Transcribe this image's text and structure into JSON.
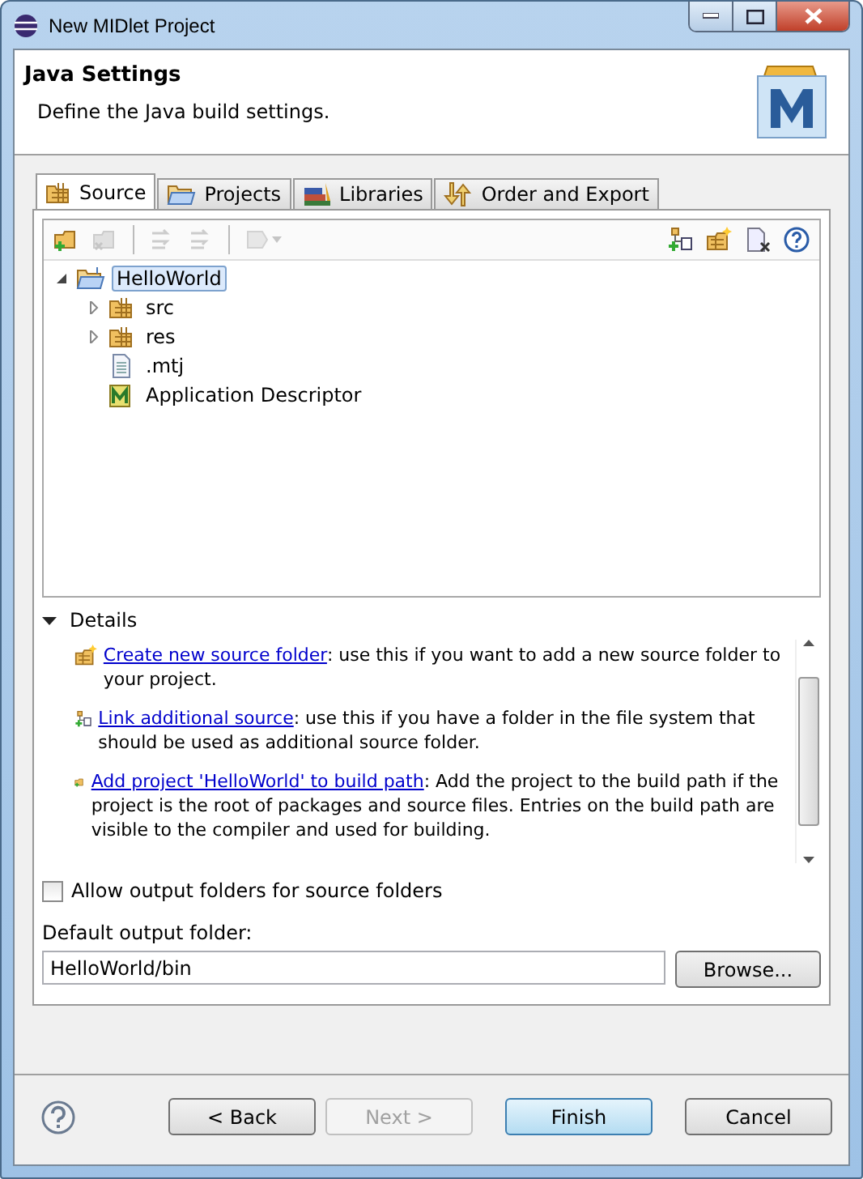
{
  "window": {
    "title": "New MIDlet Project"
  },
  "header": {
    "title": "Java Settings",
    "description": "Define the Java build settings."
  },
  "tabs": [
    {
      "label": "Source",
      "kind": "source",
      "selected": true
    },
    {
      "label": "Projects",
      "kind": "projects",
      "selected": false
    },
    {
      "label": "Libraries",
      "kind": "libraries",
      "selected": false
    },
    {
      "label": "Order and Export",
      "kind": "order",
      "selected": false
    }
  ],
  "toolbar": {
    "left": [
      {
        "kind": "add-folder",
        "disabled": false
      },
      {
        "kind": "remove-folder",
        "disabled": true
      },
      {
        "kind": "move-in",
        "disabled": true
      },
      {
        "kind": "move-out",
        "disabled": true
      },
      {
        "kind": "configure",
        "disabled": true
      }
    ],
    "right": [
      {
        "kind": "link",
        "disabled": false
      },
      {
        "kind": "new-folder",
        "disabled": false
      },
      {
        "kind": "remove",
        "disabled": false
      },
      {
        "kind": "help",
        "disabled": false
      }
    ]
  },
  "tree": [
    {
      "label": "HelloWorld",
      "kind": "project",
      "selected": true,
      "expanded": true,
      "children": [
        {
          "label": "src",
          "kind": "folder",
          "selected": false,
          "expanded": false
        },
        {
          "label": "res",
          "kind": "folder",
          "selected": false,
          "expanded": false
        },
        {
          "label": ".mtj",
          "kind": "file",
          "selected": false
        },
        {
          "label": "Application Descriptor",
          "kind": "descriptor",
          "selected": false
        }
      ]
    }
  ],
  "details": {
    "label": "Details",
    "expanded": true,
    "items": [
      {
        "kind": "new-folder",
        "link": "Create new source folder",
        "text": ": use this if you want to add a new source folder to your project."
      },
      {
        "kind": "link",
        "link": "Link additional source",
        "text": ": use this if you have a folder in the file system that should be used as additional source folder."
      },
      {
        "kind": "add-folder",
        "link": "Add project 'HelloWorld' to build path",
        "text": ": Add the project to the build path if the project is the root of packages and source files. Entries on the build path are visible to the compiler and used for building."
      }
    ]
  },
  "allow_output_folders": {
    "label": "Allow output folders for source folders",
    "checked": false
  },
  "output_folder": {
    "label": "Default output folder:",
    "value": "HelloWorld/bin",
    "browse": "Browse..."
  },
  "buttons": [
    {
      "label": "< Back",
      "disabled": false,
      "default": false
    },
    {
      "label": "Next >",
      "disabled": true,
      "default": false
    },
    {
      "label": "Finish",
      "disabled": false,
      "default": true
    },
    {
      "label": "Cancel",
      "disabled": false,
      "default": false
    }
  ]
}
